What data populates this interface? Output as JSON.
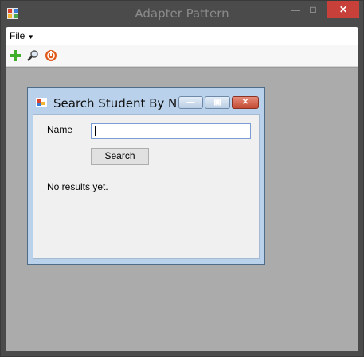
{
  "window": {
    "title": "Adapter Pattern"
  },
  "menu": {
    "file_label": "File"
  },
  "toolbar": {
    "buttons": [
      {
        "name": "add-icon"
      },
      {
        "name": "search-icon"
      },
      {
        "name": "exit-icon"
      }
    ]
  },
  "child_window": {
    "title": "Search Student By Na...",
    "name_label": "Name",
    "name_value": "",
    "search_button_label": "Search",
    "results_text": "No results yet."
  },
  "colors": {
    "title_bar": "#4b4b4b",
    "close_button": "#c7413a",
    "mdi_background": "#ababab",
    "child_frame": "#b9d1ea"
  }
}
